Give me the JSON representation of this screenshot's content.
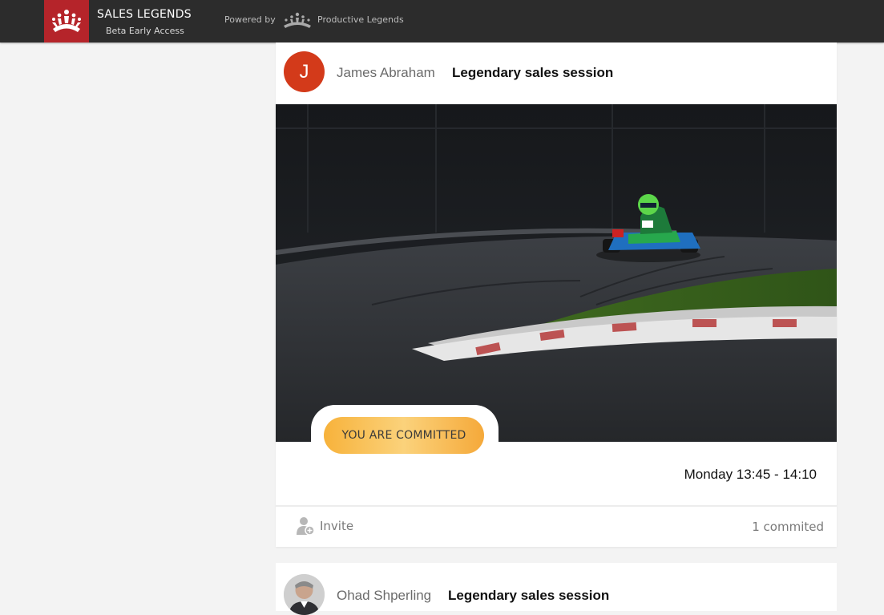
{
  "header": {
    "brand_title": "SALES LEGENDS",
    "brand_subtitle": "Beta Early Access",
    "powered_by": "Powered by",
    "partner_name": "Productive Legends",
    "colors": {
      "bar": "#2c2c2c",
      "logo_bg": "#b5242a"
    },
    "icons": [
      "crown-hands-logo",
      "productive-legends-logo"
    ]
  },
  "feed": {
    "posts": [
      {
        "author_initial": "J",
        "author": "James Abraham",
        "title": "Legendary sales session",
        "image": "go-kart-on-race-track",
        "status_badge": "YOU ARE COMMITTED",
        "time": "Monday 13:45 - 14:10",
        "invite_label": "Invite",
        "committed_count": "1 commited",
        "colors": {
          "avatar": "#d33a1a",
          "badge": "#f7b23b"
        }
      },
      {
        "author": "Ohad Shperling",
        "title": "Legendary sales session",
        "avatar": "photo-avatar"
      }
    ]
  }
}
